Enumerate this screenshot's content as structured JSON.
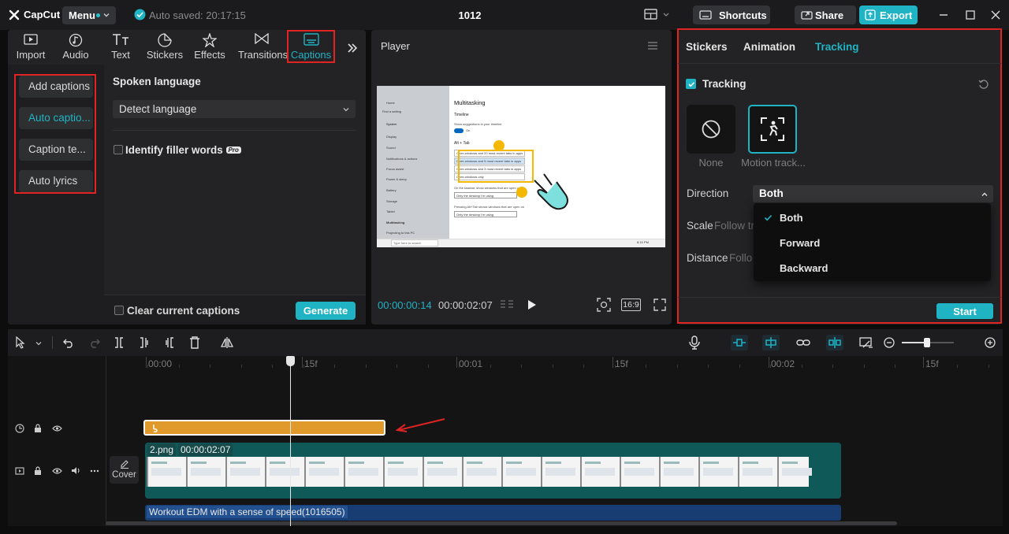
{
  "app": {
    "name": "CapCut",
    "menu_label": "Menu",
    "autosave": "Auto saved: 20:17:15",
    "project_title": "1012",
    "shortcuts_label": "Shortcuts",
    "share_label": "Share",
    "export_label": "Export"
  },
  "toolbar": {
    "tabs": [
      {
        "label": "Import",
        "icon": "import-icon"
      },
      {
        "label": "Audio",
        "icon": "audio-icon"
      },
      {
        "label": "Text",
        "icon": "text-icon"
      },
      {
        "label": "Stickers",
        "icon": "stickers-icon"
      },
      {
        "label": "Effects",
        "icon": "effects-icon"
      },
      {
        "label": "Transitions",
        "icon": "transitions-icon"
      },
      {
        "label": "Captions",
        "icon": "captions-icon",
        "active": true
      }
    ]
  },
  "captions": {
    "side_items": [
      "Add captions",
      "Auto captio...",
      "Caption te...",
      "Auto lyrics"
    ],
    "active_item": "Auto captio...",
    "spoken_language_title": "Spoken language",
    "language_value": "Detect language",
    "filler_label": "Identify filler words",
    "pro_badge": "Pro",
    "clear_label": "Clear current captions",
    "generate_label": "Generate"
  },
  "player": {
    "title": "Player",
    "current_time": "00:00:00:14",
    "total_time": "00:00:02:07",
    "ratio": "16:9",
    "preview": {
      "heading": "Multitasking",
      "section": "Timeline",
      "toggle_text": "Show suggestions in your timeline",
      "toggle_state": "On",
      "alt_tab": "Alt + Tab",
      "options": [
        "Open windows and 20 most recent tabs in apps",
        "Open windows and 5 most recent tabs in apps",
        "Open windows and 3 most recent tabs in apps",
        "Open windows only"
      ],
      "taskbar_label": "On the taskbar, show windows that are open on",
      "taskbar_value": "Only the desktop I'm using",
      "alttab_label": "Pressing Alt+Tab shows windows that are open on",
      "alttab_value": "Only the desktop I'm using",
      "sidebar_items": [
        "Home",
        "Find a setting",
        "System",
        "Display",
        "Sound",
        "Notifications & actions",
        "Focus assist",
        "Power & sleep",
        "Battery",
        "Storage",
        "Tablet",
        "Multitasking",
        "Projecting to this PC"
      ],
      "search_text": "Type here to search",
      "clock": "8:15 PM"
    }
  },
  "tracking": {
    "tabs": [
      "Stickers",
      "Animation",
      "Tracking"
    ],
    "active_tab": "Tracking",
    "enable_label": "Tracking",
    "options": [
      {
        "label": "None",
        "icon": "none-icon"
      },
      {
        "label": "Motion track...",
        "icon": "motion-track-icon"
      }
    ],
    "direction_label": "Direction",
    "direction_value": "Both",
    "scale_label": "Scale",
    "scale_value": "Follow tr",
    "distance_label": "Distance",
    "distance_value": "Follo",
    "dropdown_options": [
      "Both",
      "Forward",
      "Backward"
    ],
    "start_label": "Start"
  },
  "timeline": {
    "ruler": [
      "00:00",
      "15f",
      "00:01",
      "15f",
      "00:02",
      "15f"
    ],
    "cover_label": "Cover",
    "clip_name": "2.png",
    "clip_duration": "00:00:02:07",
    "audio_name": "Workout EDM with a sense of speed(1016505)"
  },
  "colors": {
    "accent": "#1fb3c4",
    "highlight": "#e02424",
    "sticker_track": "#e09a2b",
    "video_track": "#0f5a59",
    "audio_track": "#173d73"
  }
}
